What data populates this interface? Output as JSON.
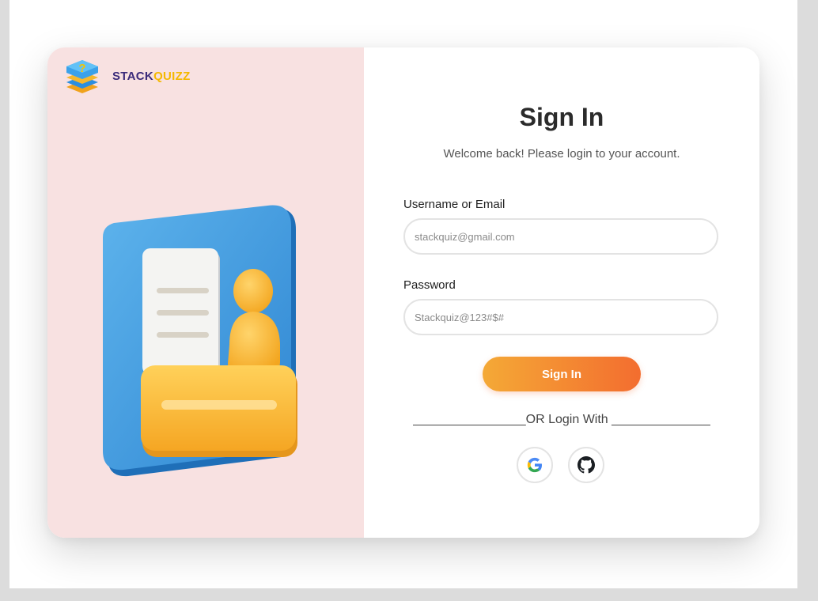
{
  "brand": {
    "name_part1": "STACK",
    "name_part2": "QUIZZ",
    "logo_icon": "stacked-layers-question-icon",
    "colors": {
      "primary": "#3b2b7a",
      "accent": "#f5b800"
    }
  },
  "illustration": {
    "icon": "profile-card-illustration"
  },
  "form": {
    "title": "Sign In",
    "subtitle": "Welcome back! Please login to your account.",
    "username_label": "Username or Email",
    "username_placeholder": "stackquiz@gmail.com",
    "password_label": "Password",
    "password_placeholder": "Stackquiz@123#$#",
    "submit_label": "Sign In",
    "divider_text": "________________OR Login With ______________",
    "social": [
      {
        "name": "google",
        "icon": "google-icon"
      },
      {
        "name": "github",
        "icon": "github-icon"
      }
    ]
  },
  "colors": {
    "left_panel_bg": "#f8e1e1",
    "button_gradient_start": "#f4a936",
    "button_gradient_end": "#f36d2f"
  }
}
